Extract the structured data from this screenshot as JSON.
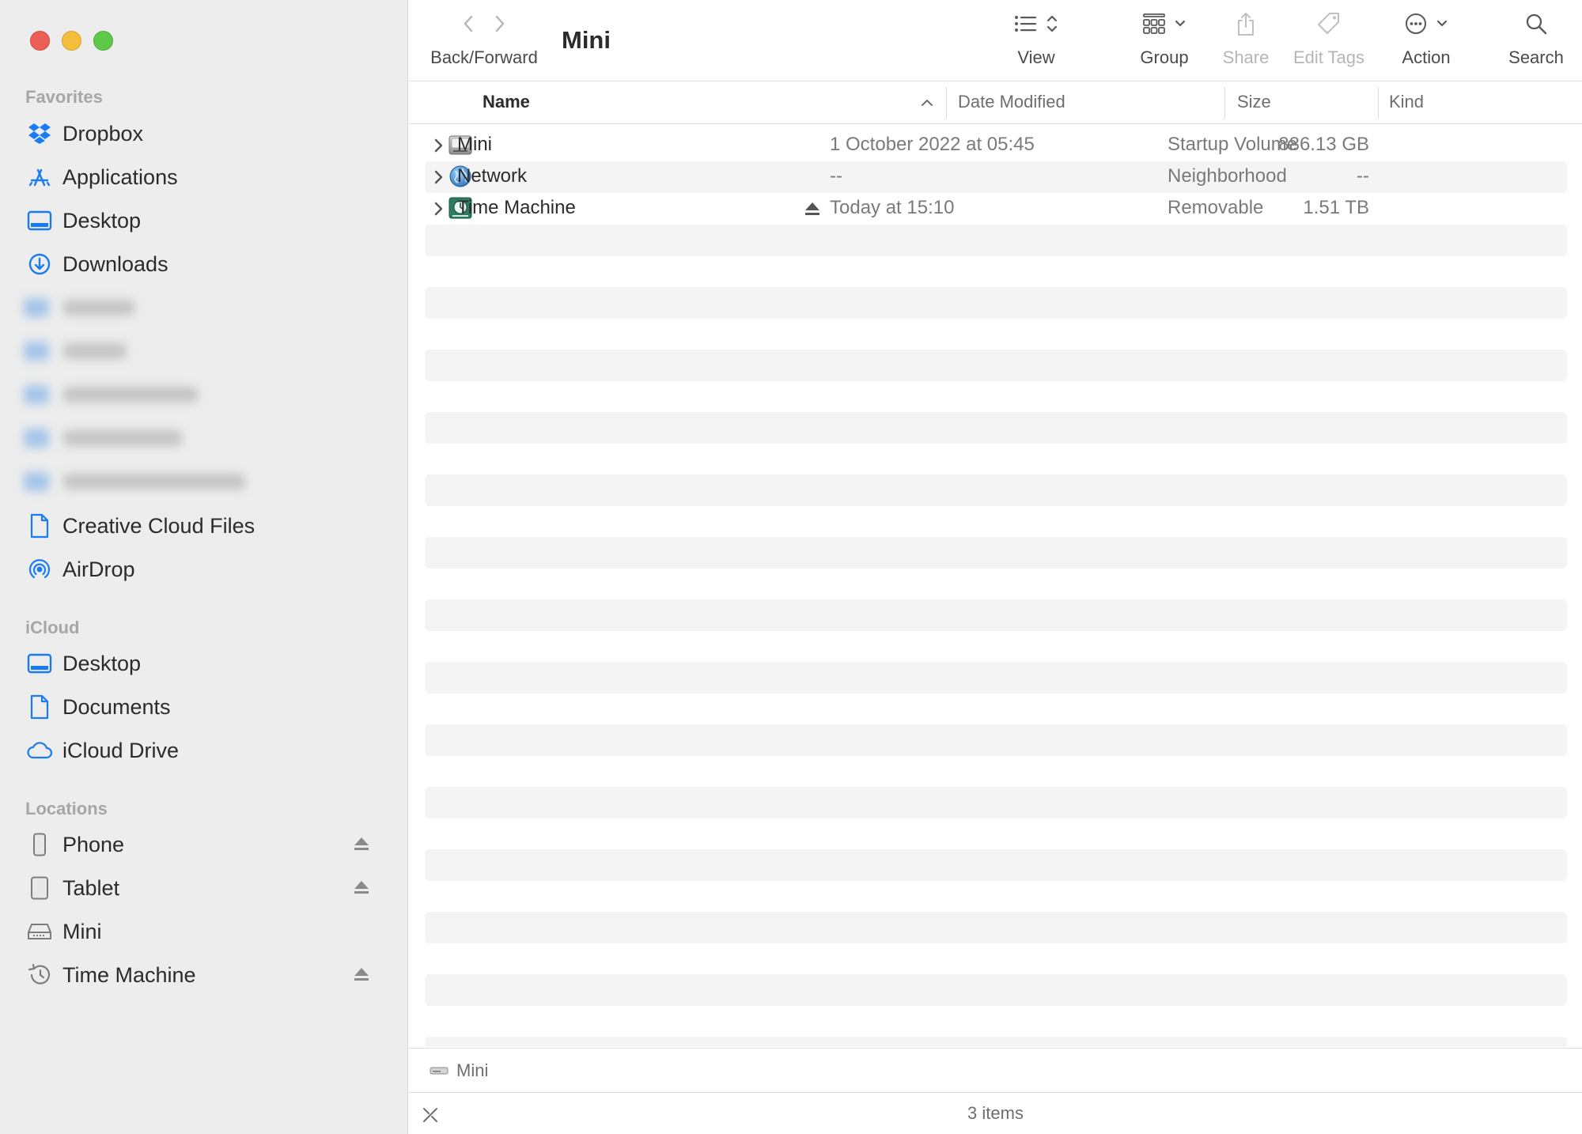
{
  "window": {
    "title": "Mini"
  },
  "sidebar": {
    "favorites_header": "Favorites",
    "favorites": [
      {
        "label": "Dropbox",
        "icon": "dropbox-icon"
      },
      {
        "label": "Applications",
        "icon": "applications-icon"
      },
      {
        "label": "Desktop",
        "icon": "desktop-icon"
      },
      {
        "label": "Downloads",
        "icon": "downloads-icon"
      },
      {
        "label": "Creative Cloud Files",
        "icon": "document-icon"
      },
      {
        "label": "AirDrop",
        "icon": "airdrop-icon"
      }
    ],
    "icloud_header": "iCloud",
    "icloud": [
      {
        "label": "Desktop",
        "icon": "desktop-icon"
      },
      {
        "label": "Documents",
        "icon": "document-icon"
      },
      {
        "label": "iCloud Drive",
        "icon": "cloud-icon"
      }
    ],
    "locations_header": "Locations",
    "locations": [
      {
        "label": "Phone",
        "icon": "phone-icon",
        "ejectable": true
      },
      {
        "label": "Tablet",
        "icon": "tablet-icon",
        "ejectable": true
      },
      {
        "label": "Mini",
        "icon": "hard-drive-icon",
        "ejectable": false
      },
      {
        "label": "Time Machine",
        "icon": "time-machine-icon",
        "ejectable": true
      }
    ]
  },
  "toolbar": {
    "back_forward_label": "Back/Forward",
    "view_label": "View",
    "group_label": "Group",
    "share_label": "Share",
    "edit_tags_label": "Edit Tags",
    "action_label": "Action",
    "search_label": "Search"
  },
  "columns": {
    "name": "Name",
    "date_modified": "Date Modified",
    "size": "Size",
    "kind": "Kind"
  },
  "rows": [
    {
      "name": "Mini",
      "date": "1 October 2022 at 05:45",
      "size": "886.13 GB",
      "kind": "Startup Volume",
      "icon": "hard-drive-icon",
      "eject": false
    },
    {
      "name": "Network",
      "date": "--",
      "size": "--",
      "kind": "Neighborhood",
      "icon": "network-globe-icon",
      "eject": false
    },
    {
      "name": "Time Machine",
      "date": "Today at 15:10",
      "size": "1.51 TB",
      "kind": "Removable",
      "icon": "time-machine-drive-icon",
      "eject": true
    }
  ],
  "pathbar": {
    "item": "Mini"
  },
  "status": {
    "items_count": "3 items"
  },
  "colors": {
    "accent": "#1a7cf5",
    "sidebar_bg": "#ededed",
    "row_alt": "#f4f4f4"
  }
}
